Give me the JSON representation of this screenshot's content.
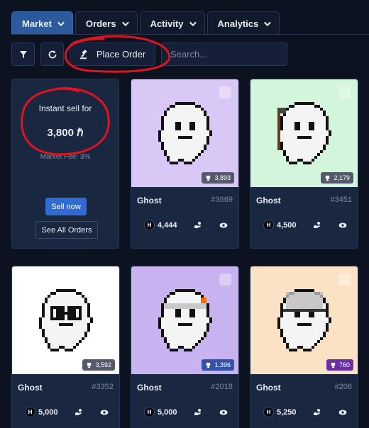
{
  "tabs": [
    {
      "label": "Market"
    },
    {
      "label": "Orders"
    },
    {
      "label": "Activity"
    },
    {
      "label": "Analytics"
    }
  ],
  "toolbar": {
    "filter_icon": "funnel-icon",
    "refresh_icon": "refresh-icon",
    "place_order_label": "Place Order",
    "search_placeholder": "Search..."
  },
  "sell_panel": {
    "label": "Instant sell for",
    "amount": "3,800 ℏ",
    "fee": "Market Fee: 3%",
    "sell_now": "Sell now",
    "see_all": "See All Orders"
  },
  "cards": [
    {
      "name": "Ghost",
      "id": "#3669",
      "rank": "3,893",
      "price": "4,444",
      "bg": "#d9c8f6"
    },
    {
      "name": "Ghost",
      "id": "#3451",
      "rank": "2,179",
      "price": "4,500",
      "bg": "#d2f5dc"
    },
    {
      "name": "Ghost",
      "id": "#3352",
      "rank": "3,592",
      "price": "5,000",
      "bg": "#ffffff"
    },
    {
      "name": "Ghost",
      "id": "#2018",
      "rank": "1,396",
      "price": "5,000",
      "bg": "#c8b2f0"
    },
    {
      "name": "Ghost",
      "id": "#206",
      "rank": "760",
      "price": "5,250",
      "bg": "#fbe2c4"
    }
  ],
  "coin_symbol": "H",
  "colors": {
    "accent": "#2f6bd1",
    "annotation": "#e0141e"
  }
}
